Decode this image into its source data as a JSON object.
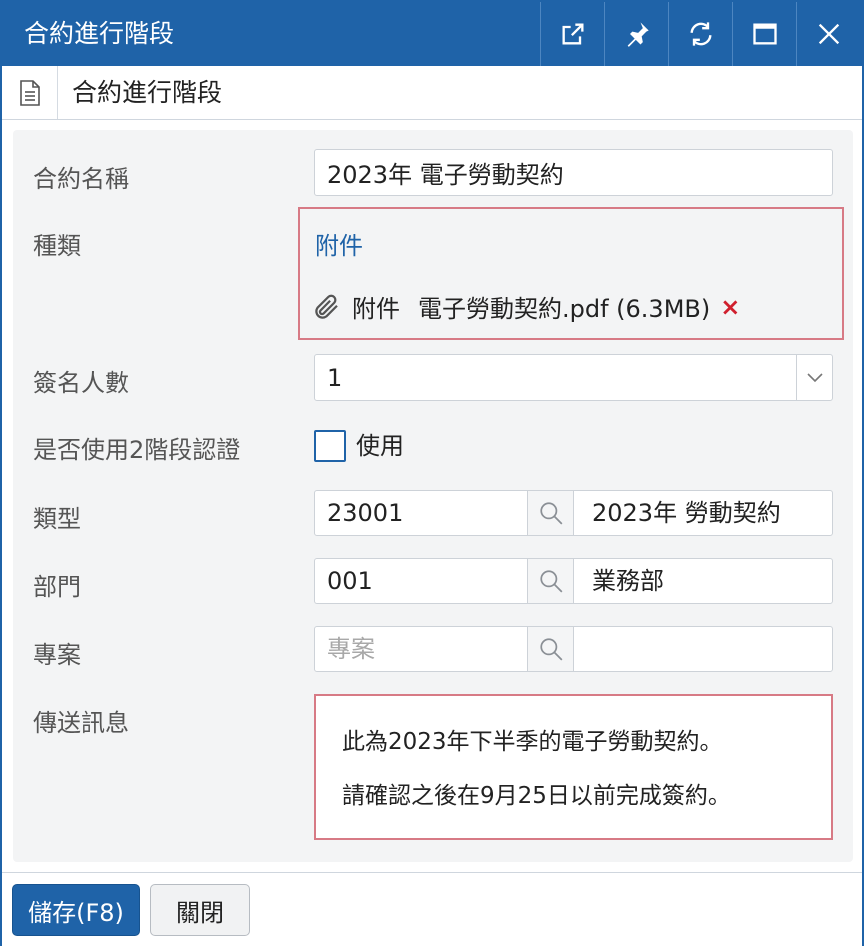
{
  "window": {
    "title": "合約進行階段",
    "controls": [
      "external-link-icon",
      "pin-icon",
      "refresh-icon",
      "maximize-icon",
      "close-icon"
    ]
  },
  "subheader": {
    "title": "合約進行階段",
    "icon": "document-icon"
  },
  "form": {
    "contract_name": {
      "label": "合約名稱",
      "value": "2023年 電子勞動契約"
    },
    "attachment": {
      "label": "種類",
      "link": "附件",
      "item_prefix": "附件",
      "file": "電子勞動契約.pdf (6.3MB)",
      "remove": "×"
    },
    "signers": {
      "label": "簽名人數",
      "value": "1"
    },
    "two_step": {
      "label": "是否使用2階段認證",
      "checkbox_label": "使用",
      "checked": false
    },
    "type": {
      "label": "類型",
      "code": "23001",
      "name": "2023年 勞動契約"
    },
    "department": {
      "label": "部門",
      "code": "001",
      "name": "業務部"
    },
    "project": {
      "label": "專案",
      "placeholder": "專案",
      "name": ""
    },
    "message": {
      "label": "傳送訊息",
      "lines": [
        "此為2023年下半季的電子勞動契約。",
        "請確認之後在9月25日以前完成簽約。"
      ]
    }
  },
  "footer": {
    "save": "儲存(F8)",
    "close": "關閉"
  },
  "colors": {
    "primary": "#1f63a8",
    "highlight_border": "#d77a85",
    "remove": "#d0202e"
  }
}
